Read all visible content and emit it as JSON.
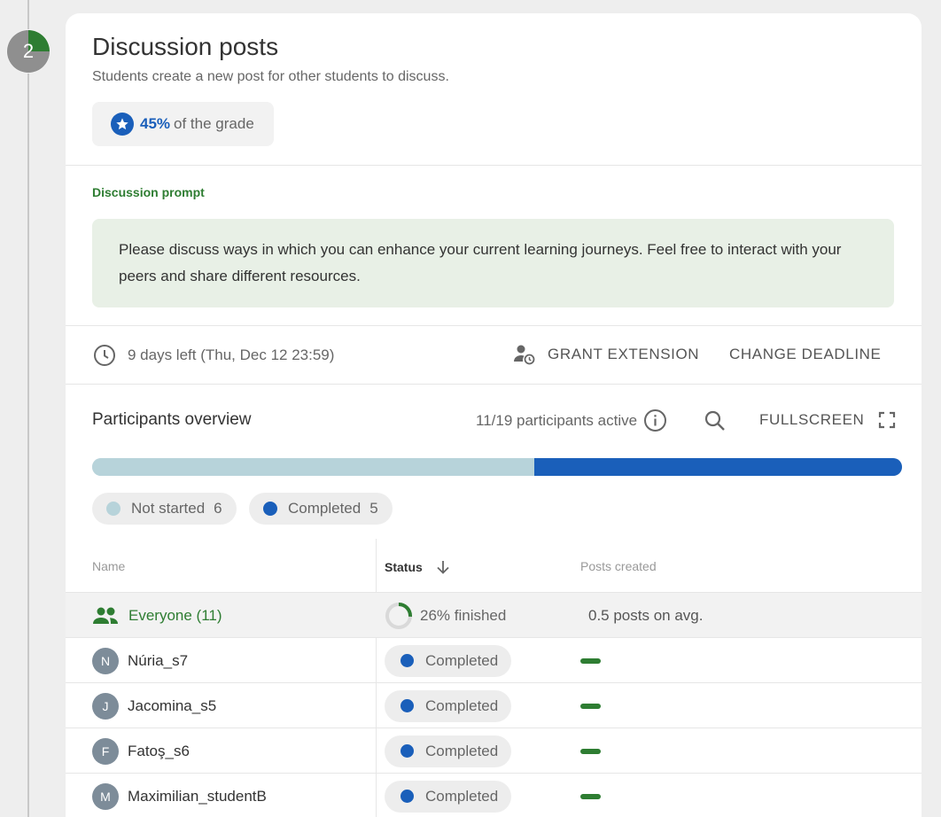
{
  "step": {
    "number": "2",
    "progress_fraction": 0.25
  },
  "activity": {
    "title": "Discussion posts",
    "subtitle": "Students create a new post for other students to discuss.",
    "grade_percent": "45%",
    "grade_suffix": "of the grade"
  },
  "prompt": {
    "label": "Discussion prompt",
    "text": "Please discuss ways in which you can enhance your current learning journeys. Feel free to interact with your peers and share different resources."
  },
  "deadline": {
    "text": "9 days left (Thu, Dec 12 23:59)",
    "grant_label": "GRANT EXTENSION",
    "change_label": "CHANGE DEADLINE"
  },
  "overview": {
    "title": "Participants overview",
    "active_text": "11/19 participants active",
    "fullscreen_label": "FULLSCREEN",
    "segments": [
      {
        "label": "Not started",
        "count": "6",
        "value": 6,
        "color": "#b7d3da"
      },
      {
        "label": "Completed",
        "count": "5",
        "value": 5,
        "color": "#1a5fba"
      }
    ]
  },
  "table": {
    "headers": {
      "name": "Name",
      "status": "Status",
      "posts": "Posts created"
    },
    "summary": {
      "name": "Everyone (11)",
      "finished_fraction": 0.26,
      "finished_text": "26% finished",
      "posts_text": "0.5 posts on avg."
    },
    "rows": [
      {
        "initial": "N",
        "name": "Núria_s7",
        "status": "Completed"
      },
      {
        "initial": "J",
        "name": "Jacomina_s5",
        "status": "Completed"
      },
      {
        "initial": "F",
        "name": "Fatoş_s6",
        "status": "Completed"
      },
      {
        "initial": "M",
        "name": "Maximilian_studentB",
        "status": "Completed"
      }
    ]
  },
  "colors": {
    "accent_green": "#2e7d32",
    "accent_blue": "#1a5fba",
    "not_started": "#b7d3da"
  }
}
